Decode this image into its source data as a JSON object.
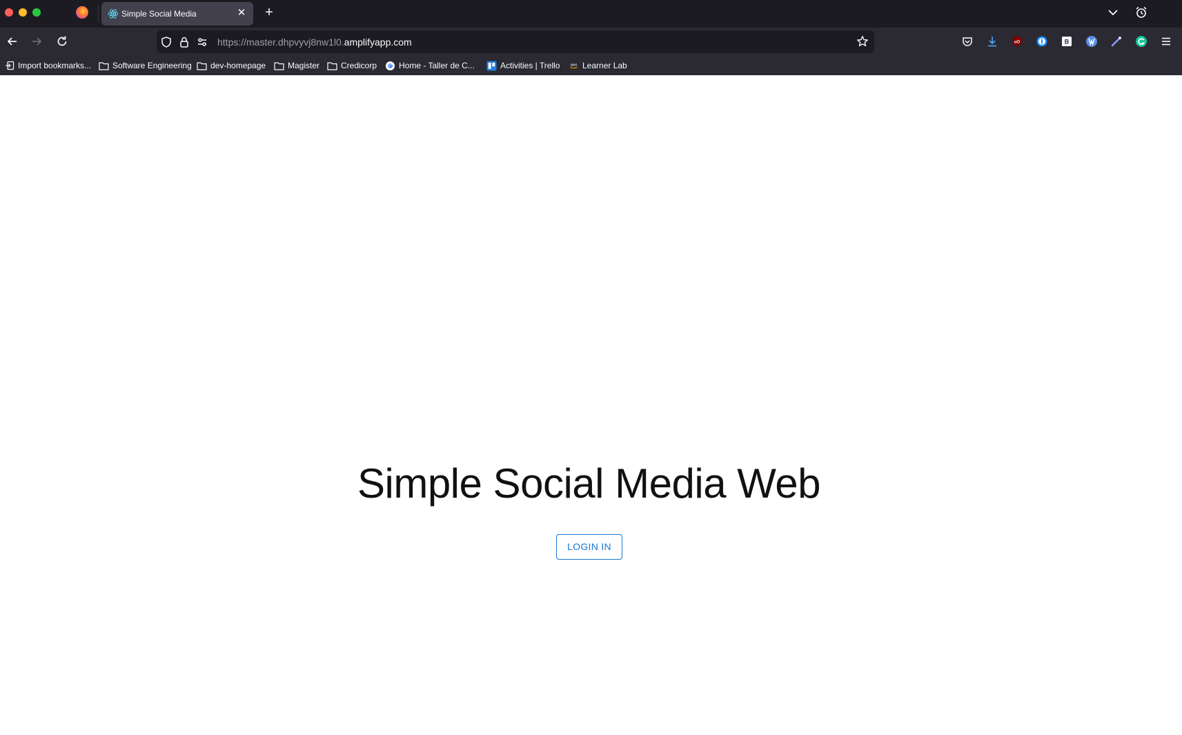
{
  "browser": {
    "tab": {
      "title": "Simple Social Media",
      "close_glyph": "✕"
    },
    "newtab_glyph": "+",
    "url": {
      "scheme_prefix": "https://master.dhpvyvj8nw1l0.",
      "host": "amplifyapp.com"
    },
    "bookmarks": [
      {
        "label": "Import bookmarks...",
        "icon": "import-icon"
      },
      {
        "label": "Software Engineering",
        "icon": "folder-icon"
      },
      {
        "label": "dev-homepage",
        "icon": "folder-icon"
      },
      {
        "label": "Magister",
        "icon": "folder-icon"
      },
      {
        "label": "Credicorp",
        "icon": "folder-icon"
      },
      {
        "label": "Home - Taller de C...",
        "icon": "google-icon"
      },
      {
        "label": "Activities | Trello",
        "icon": "trello-icon"
      },
      {
        "label": "Learner Lab",
        "icon": "aws-icon"
      }
    ]
  },
  "page": {
    "title": "Simple Social Media Web",
    "login_label": "LOGIN IN",
    "accent_color": "#1976d2"
  }
}
